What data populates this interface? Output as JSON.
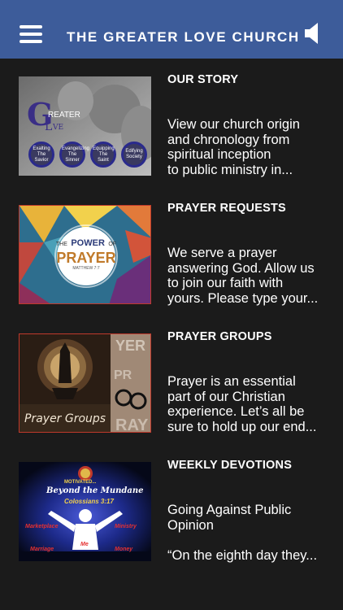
{
  "header": {
    "title": "THE GREATER LOVE CHURCH",
    "menu_icon": "hamburger-menu-icon",
    "sound_icon": "speaker-icon",
    "bar_color": "#3d5c9a"
  },
  "items": [
    {
      "title": "OUR STORY",
      "lines": [
        "View our church origin",
        "and chronology from",
        "spiritual inception",
        "to public ministry in..."
      ],
      "thumb": {
        "logo_g": "G",
        "logo_text": [
          "REATER",
          "L",
          "VE"
        ],
        "circles": [
          [
            "Exalting",
            "The",
            "Savior"
          ],
          [
            "Evangelizing",
            "The",
            "Sinner"
          ],
          [
            "Equipping",
            "The",
            "Saint"
          ],
          [
            "Edifying",
            "Society"
          ]
        ]
      }
    },
    {
      "title": "PRAYER REQUESTS",
      "lines": [
        "We serve a prayer",
        "answering God. Allow us",
        "to join our faith with",
        "yours. Please type your..."
      ],
      "thumb": {
        "the": "THE",
        "power": "POWER",
        "of": "OF",
        "prayer": "PRAYER",
        "verse": "MATTHEW 7:7"
      }
    },
    {
      "title": "PRAYER GROUPS",
      "lines": [
        "Prayer is an essential",
        "part of our Christian",
        "experience. Let’s all be",
        "sure to hold up our end..."
      ],
      "thumb": {
        "caption": "Prayer Groups"
      }
    },
    {
      "title": "WEEKLY DEVOTIONS",
      "lines": [
        "Going Against Public",
        "Opinion",
        "",
        "“On the eighth day they..."
      ],
      "thumb": {
        "motivated": "MOTIVATED...",
        "beyond": "Beyond the Mundane",
        "verse": "Colossians 3:17",
        "marketplace": "Marketplace",
        "ministry": "Ministry",
        "marriage": "Marriage",
        "me": "Me",
        "money": "Money"
      }
    }
  ]
}
